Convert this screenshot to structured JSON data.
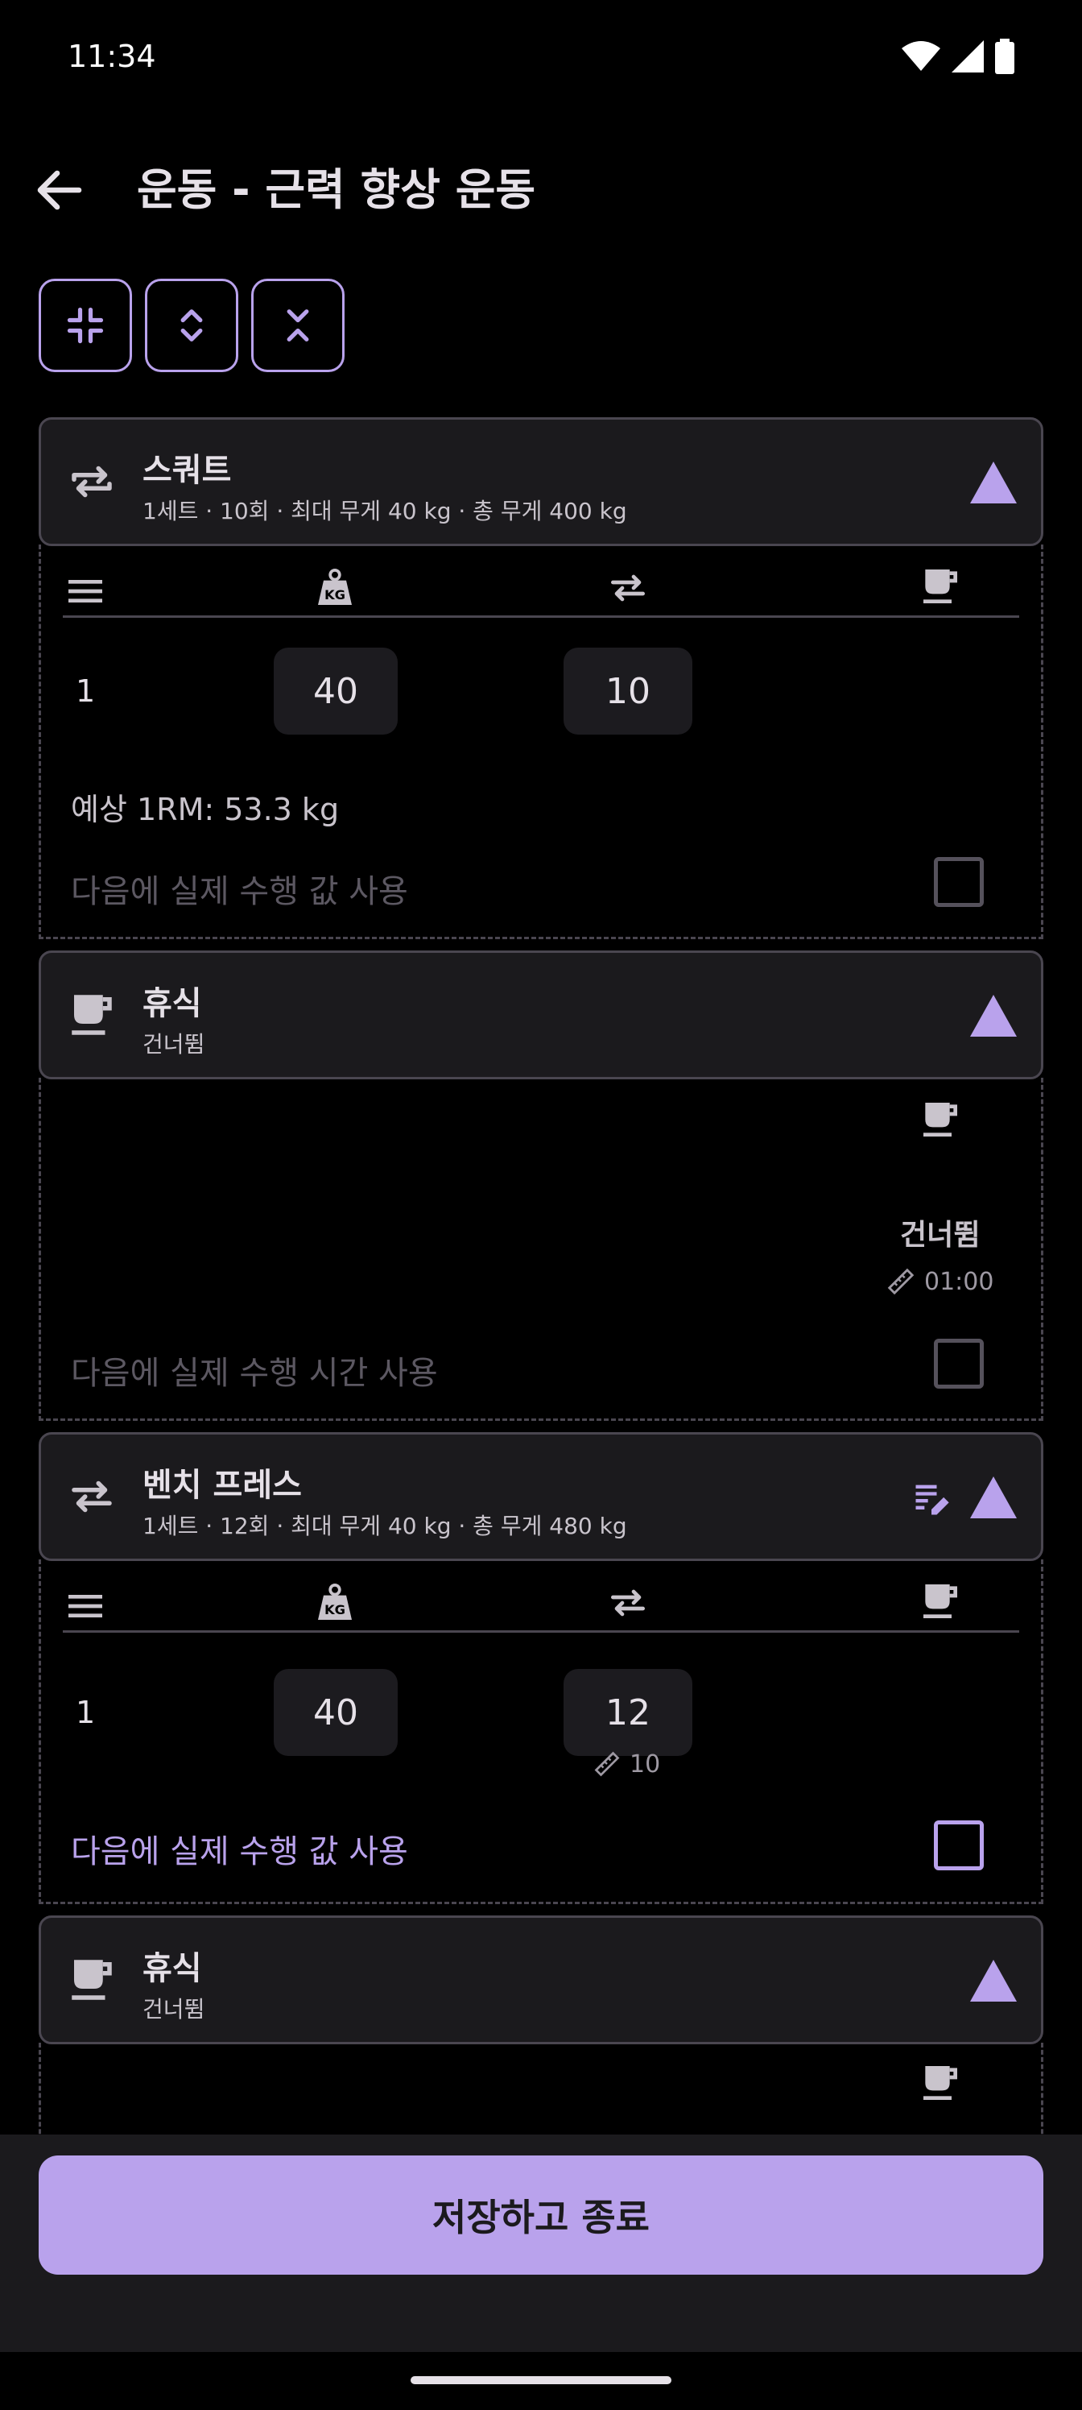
{
  "status_bar": {
    "time": "11:34",
    "icons": [
      "wifi-icon",
      "cellular-signal-icon",
      "battery-icon"
    ]
  },
  "app_bar": {
    "title": "운동 - 근력 향상 운동",
    "back_icon": "arrow-left-icon"
  },
  "toolbar": {
    "buttons": [
      "collapse-all-icon",
      "expand-icon",
      "shrink-icon"
    ]
  },
  "accent_color": "#b9a2ec",
  "blocks": [
    {
      "type": "exercise",
      "title": "스쿼트",
      "subtitle": "1세트 · 10회 · 최대 무게 40 kg · 총 무게 400 kg",
      "sets": [
        {
          "num": "1",
          "weight": "40",
          "reps": "10"
        }
      ],
      "estimated_1rm": "예상 1RM: 53.3 kg",
      "use_actual_label": "다음에 실제 수행 값 사용",
      "use_actual_checked": false,
      "use_actual_enabled": false
    },
    {
      "type": "rest",
      "title": "휴식",
      "subtitle": "건너뜀",
      "status": "건너뜀",
      "duration": "01:00",
      "use_actual_label": "다음에 실제 수행 시간 사용",
      "use_actual_checked": false,
      "use_actual_enabled": false
    },
    {
      "type": "exercise",
      "title": "벤치 프레스",
      "subtitle": "1세트 · 12회 · 최대 무게 40 kg · 총 무게 480 kg",
      "sets": [
        {
          "num": "1",
          "weight": "40",
          "reps": "12",
          "target_reps": "10"
        }
      ],
      "use_actual_label": "다음에 실제 수행 값 사용",
      "use_actual_checked": false,
      "use_actual_enabled": true
    },
    {
      "type": "rest",
      "title": "휴식",
      "subtitle": "건너뜀"
    }
  ],
  "save_button": {
    "label": "저장하고 종료"
  }
}
